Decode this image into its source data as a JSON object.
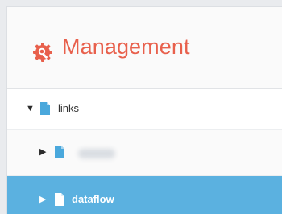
{
  "header": {
    "title": "Management",
    "icon": "gear-search-icon",
    "accent_color": "#e8604c"
  },
  "tree": {
    "root": {
      "label": "links",
      "expanded": true,
      "icon": "file-icon"
    },
    "children": [
      {
        "label": "",
        "label_obscured": true,
        "expanded": false,
        "icon": "file-icon",
        "selected": false
      },
      {
        "label": "dataflow",
        "expanded": false,
        "icon": "file-icon",
        "selected": true
      }
    ]
  },
  "colors": {
    "selection": "#5bb1e0",
    "file_icon": "#4aa8dc"
  }
}
